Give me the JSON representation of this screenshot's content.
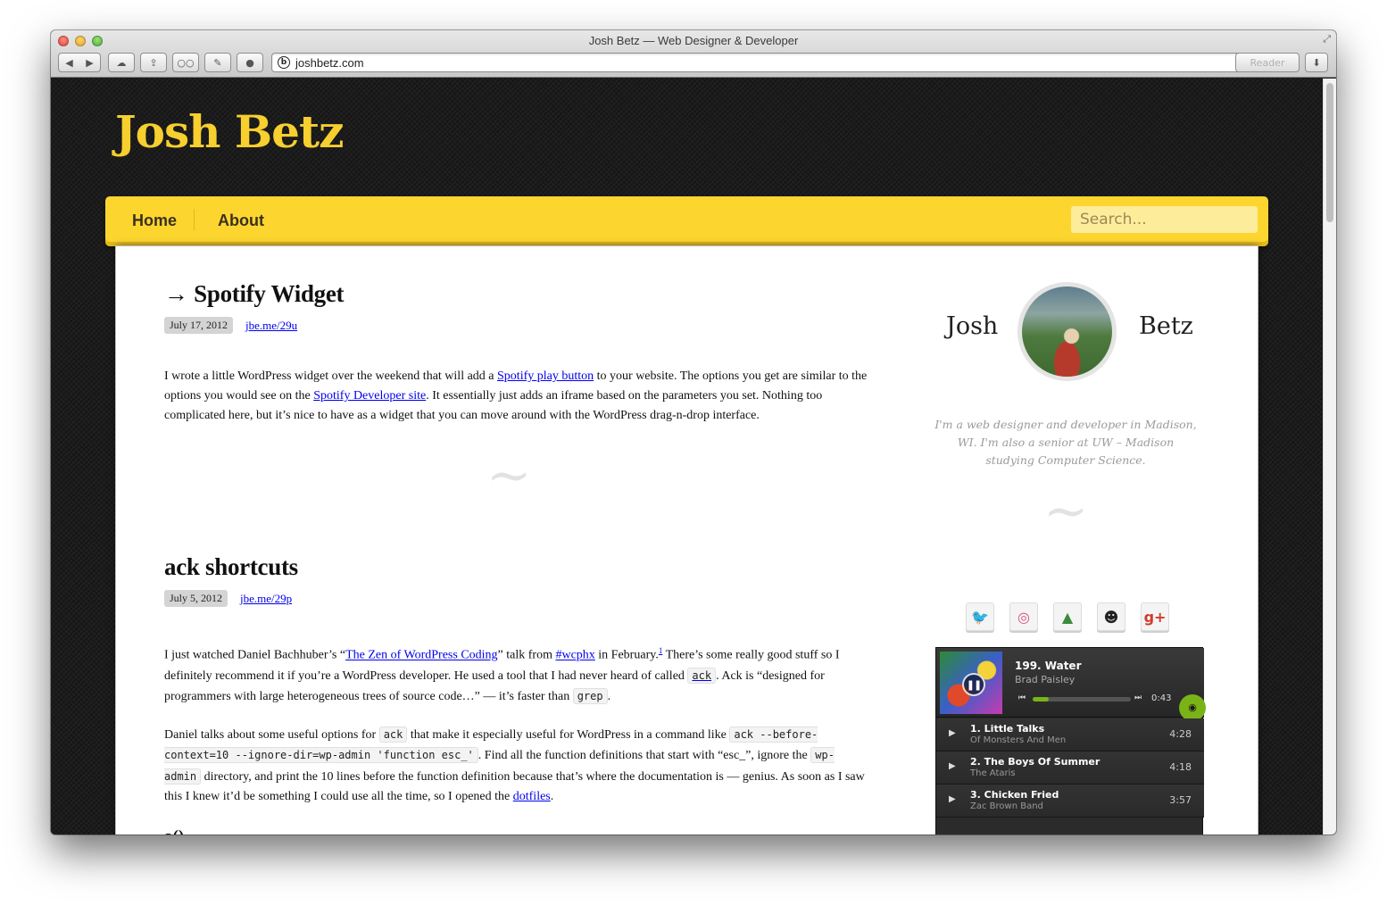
{
  "browser": {
    "window_title": "Josh Betz — Web Designer & Developer",
    "url": "joshbetz.com",
    "reader_label": "Reader"
  },
  "site": {
    "logo": "Josh Betz",
    "nav": [
      "Home",
      "About"
    ],
    "search_placeholder": "Search..."
  },
  "posts": [
    {
      "title": "→ Spotify Widget",
      "date": "July 17, 2012",
      "shortlink": "jbe.me/29u",
      "p1_a": "I wrote a little WordPress widget over the weekend that will add a ",
      "p1_link1": "Spotify play button",
      "p1_b": " to your website. The options you get are similar to the options you would see on the ",
      "p1_link2": "Spotify Developer site",
      "p1_c": ". It essentially just adds an iframe based on the parameters you set. Nothing too complicated here, but it’s nice to have as a widget that you can move around with the WordPress drag-n-drop interface."
    },
    {
      "title": "ack shortcuts",
      "date": "July 5, 2012",
      "shortlink": "jbe.me/29p",
      "p1_a": "I just watched Daniel Bachhuber’s “",
      "p1_link1": "The Zen of WordPress Coding",
      "p1_b": "” talk from ",
      "p1_link2": "#wcphx",
      "p1_c": " in February.",
      "p1_sup": "1",
      "p1_d": " There’s some really good stuff so I definitely recommend it if you’re a WordPress developer. He used a tool that I had never heard of called ",
      "p1_code1": "ack",
      "p1_e": ". Ack is “designed for programmers with large heterogeneous trees of source code…” — it’s faster than ",
      "p1_code2": "grep",
      "p1_f": ".",
      "p2_a": "Daniel talks about some useful options for ",
      "p2_code1": "ack",
      "p2_b": " that make it especially useful for WordPress in a command like ",
      "p2_code2": "ack --before-context=10 --ignore-dir=wp-admin 'function esc_'",
      "p2_c": ". Find all the function definitions that start with “esc_”, ignore the ",
      "p2_code3": "wp-admin",
      "p2_d": " directory, and print the 10 lines before the function definition because that’s where the documentation is — genius. As soon as I saw this I knew it’d be something I could use all the time, so I opened the ",
      "p2_link1": "dotfiles",
      "p2_e": ".",
      "subheading": "a()"
    }
  ],
  "divider": "~",
  "sidebar": {
    "first_name": "Josh",
    "last_name": "Betz",
    "bio": "I'm a web designer and developer in Madison, WI. I'm also a senior at UW – Madison studying Computer Science.",
    "social": [
      {
        "icon": "twitter-icon",
        "glyph": "🐦",
        "color": "#2fa6e0"
      },
      {
        "icon": "dribbble-icon",
        "glyph": "◎",
        "color": "#e04c86"
      },
      {
        "icon": "tree-icon",
        "glyph": "▲",
        "color": "#3d8a3f"
      },
      {
        "icon": "github-icon",
        "glyph": "☻",
        "color": "#222222"
      },
      {
        "icon": "google-plus-icon",
        "glyph": "g+",
        "color": "#d23b2a"
      }
    ]
  },
  "spotify": {
    "now_playing_title": "199. Water",
    "now_playing_artist": "Brad Paisley",
    "elapsed": "0:43",
    "progress": 0.16,
    "logo": "◉",
    "tracks": [
      {
        "title": "1. Little Talks",
        "artist": "Of Monsters And Men",
        "duration": "4:28"
      },
      {
        "title": "2. The Boys Of Summer",
        "artist": "The Ataris",
        "duration": "4:18"
      },
      {
        "title": "3. Chicken Fried",
        "artist": "Zac Brown Band",
        "duration": "3:57"
      }
    ]
  },
  "colors": {
    "brand_yellow": "#fcd62f",
    "logo_yellow": "#f7cf2e",
    "link_blue": "#0000ee",
    "spotify_green": "#7ab317"
  }
}
